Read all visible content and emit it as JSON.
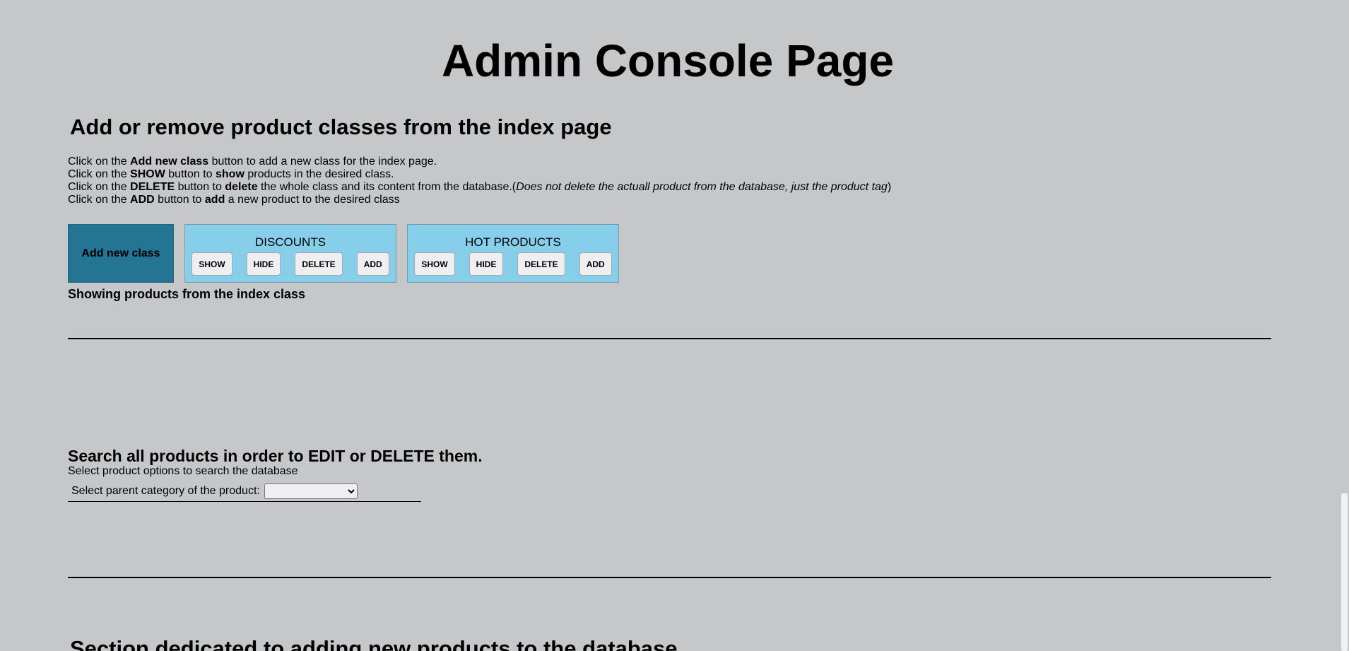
{
  "page": {
    "title": "Admin Console Page"
  },
  "index_classes": {
    "heading": "Add or remove product classes from the index page",
    "instructions": [
      {
        "prefix": "Click on the ",
        "b1": "Add new class",
        "mid": " button to add a new class for the index page.",
        "b2": "",
        "suffix": "",
        "em": "",
        "tail": ""
      },
      {
        "prefix": "Click on the ",
        "b1": "SHOW",
        "mid": " button to ",
        "b2": "show",
        "suffix": " products in the desired class.",
        "em": "",
        "tail": ""
      },
      {
        "prefix": "Click on the ",
        "b1": "DELETE",
        "mid": " button to ",
        "b2": "delete",
        "suffix": " the whole class and its content from the database.(",
        "em": "Does not delete the actuall product from the database, just the product tag",
        "tail": ")"
      },
      {
        "prefix": "Click on the ",
        "b1": "ADD",
        "mid": " button to ",
        "b2": "add",
        "suffix": " a new product to the desired class",
        "em": "",
        "tail": ""
      }
    ],
    "add_new_class_label": "Add new class",
    "classes": [
      {
        "name": "DISCOUNTS",
        "buttons": [
          "SHOW",
          "HIDE",
          "DELETE",
          "ADD"
        ]
      },
      {
        "name": "HOT PRODUCTS",
        "buttons": [
          "SHOW",
          "HIDE",
          "DELETE",
          "ADD"
        ]
      }
    ],
    "showing_label": "Showing products from the index class"
  },
  "search": {
    "heading": "Search all products in order to EDIT or DELETE them.",
    "subheading": "Select product options to search the database",
    "category_label": "Select parent category of the product:",
    "category_value": ""
  },
  "new_products": {
    "heading": "Section dedicated to adding new products to the database"
  },
  "colors": {
    "background": "#c6c7c9",
    "add_class_button": "#247593",
    "class_box": "#87ceeb"
  }
}
